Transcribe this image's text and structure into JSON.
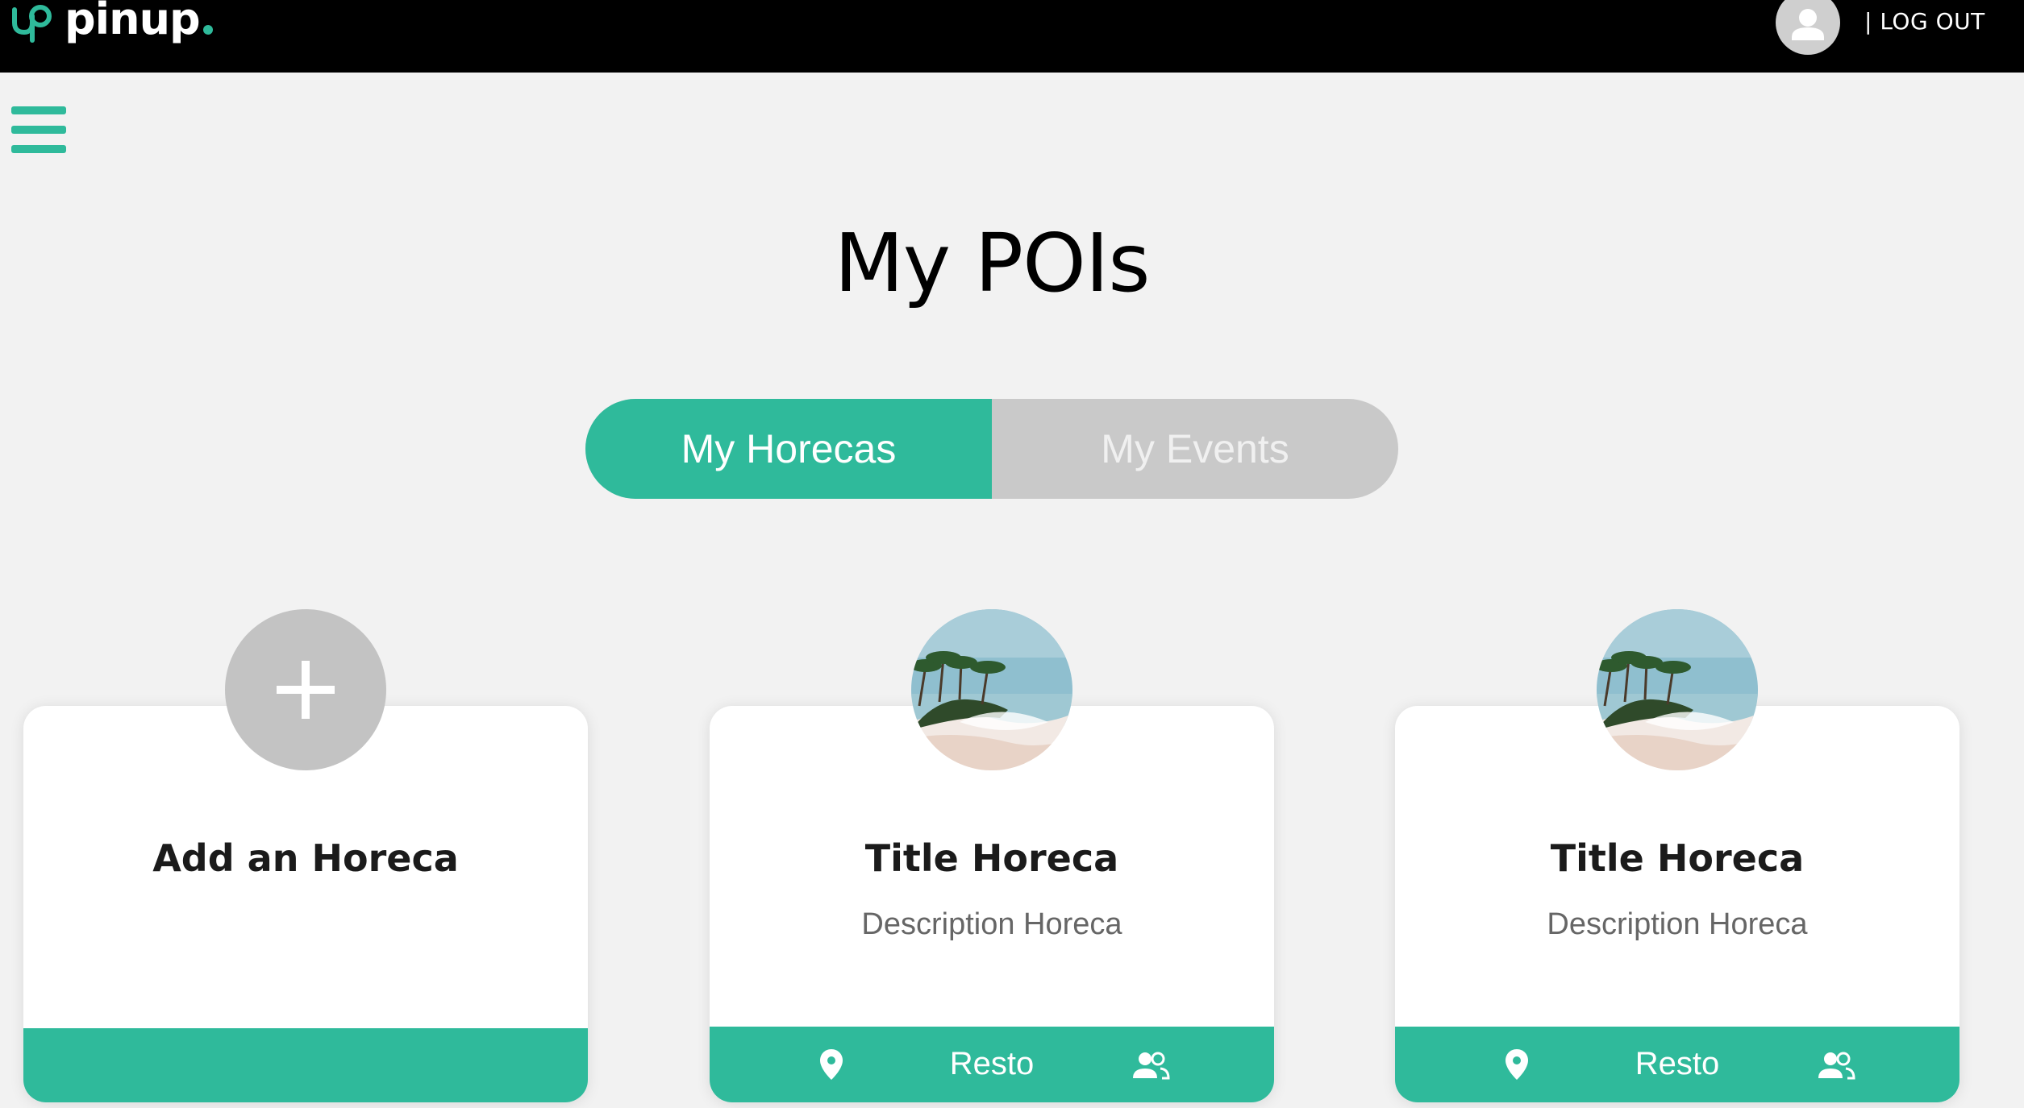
{
  "header": {
    "brand": "pinup",
    "logout_label": "| LOG OUT",
    "logo_icon": "pinup-logo-icon",
    "avatar_icon": "user-avatar-icon"
  },
  "menu": {
    "icon": "hamburger-menu-icon"
  },
  "page": {
    "title": "My POIs"
  },
  "tabs": [
    {
      "label": "My Horecas",
      "active": true
    },
    {
      "label": "My Events",
      "active": false
    }
  ],
  "cards": [
    {
      "title": "Add an Horeca",
      "type": "add"
    },
    {
      "title": "Title Horeca",
      "description": "Description Horeca",
      "category": "Resto",
      "image": "beach-palm-trees"
    },
    {
      "title": "Title Horeca",
      "description": "Description Horeca",
      "category": "Resto",
      "image": "beach-palm-trees"
    }
  ],
  "colors": {
    "accent": "#2fba9b",
    "topbar": "#000000",
    "background": "#f2f2f2",
    "toggle_inactive": "#c9c9c9",
    "add_circle": "#c3c3c3"
  }
}
